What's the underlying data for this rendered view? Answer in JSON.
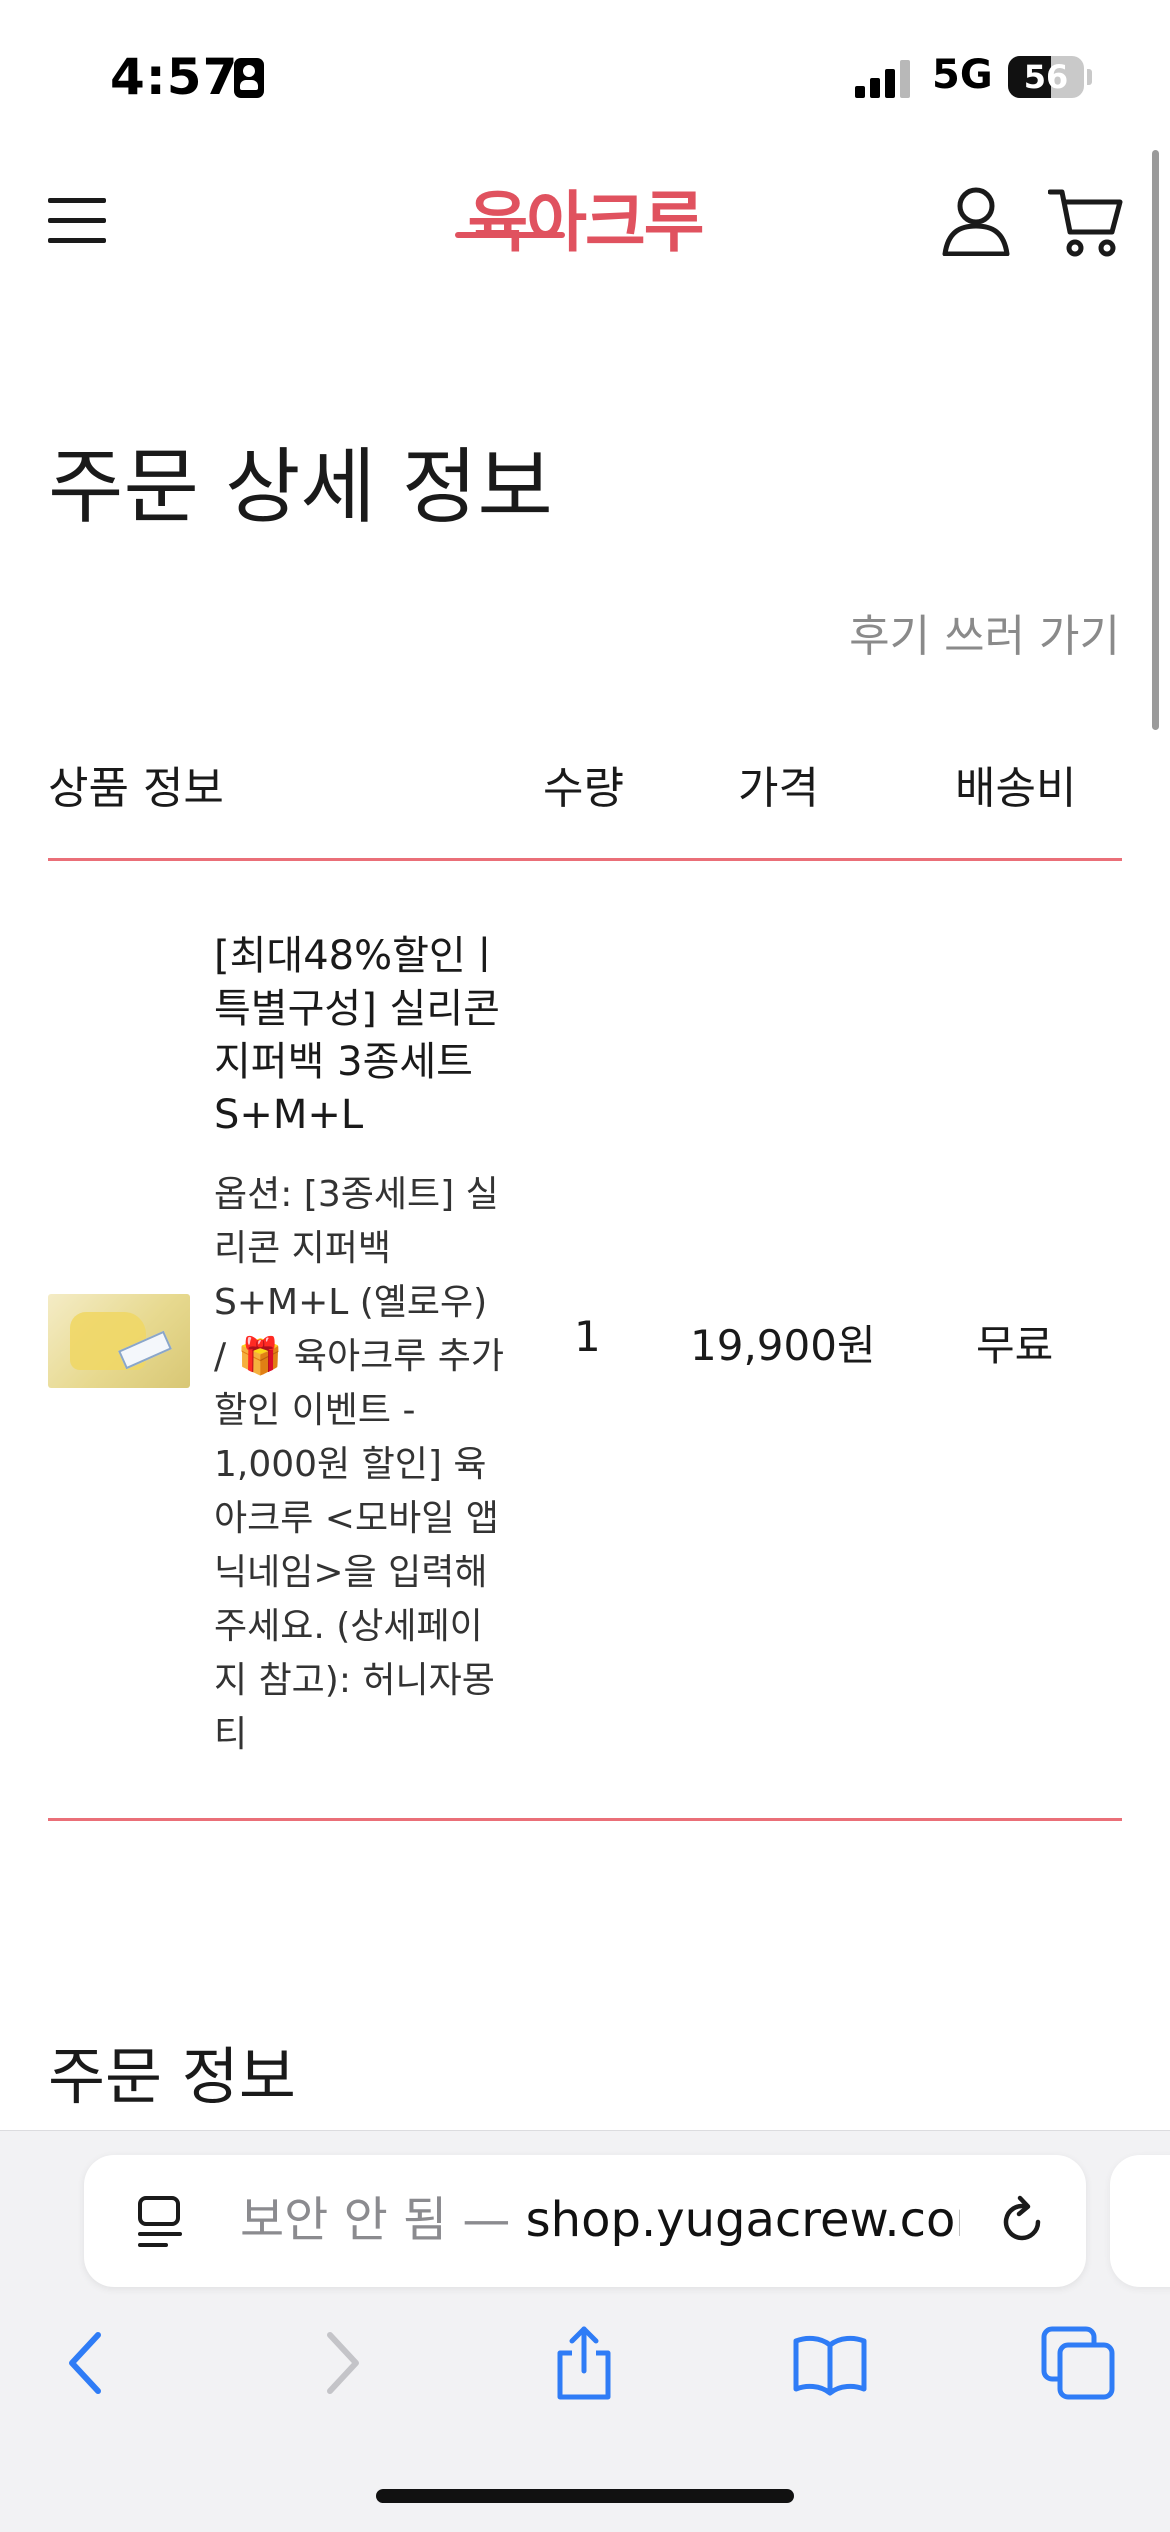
{
  "status_bar": {
    "time": "4:57",
    "network": "5G",
    "battery": "56",
    "battery_level": 0.56
  },
  "header": {
    "logo": "육아크루",
    "brand_color": "#e0525f"
  },
  "page": {
    "title": "주문 상세 정보",
    "review_link": "후기 쓰러 가기"
  },
  "table": {
    "headers": {
      "product": "상품 정보",
      "qty": "수량",
      "price": "가격",
      "shipping": "배송비"
    },
    "rows": [
      {
        "name": "[최대48%할인ㅣ특별구성] 실리콘 지퍼백 3종세트 S+M+L",
        "option": "옵션: [3종세트] 실리콘 지퍼백 S+M+L (옐로우) / 🎁 육아크루 추가할인 이벤트 - 1,000원 할인] 육아크루 <모바일 앱 닉네임>을 입력해주세요. (상세페이지 참고): 허니자몽티",
        "qty": "1",
        "price": "19,900원",
        "shipping": "무료"
      }
    ]
  },
  "order_section": {
    "title": "주문 정보"
  },
  "browser": {
    "url_prefix": "보안 안 됨 — ",
    "url_domain": "shop.yugacrew.com"
  },
  "icons": {
    "menu": "hamburger-menu-icon",
    "user": "user-icon",
    "cart": "cart-icon",
    "reader": "reader-mode-icon",
    "reload": "reload-icon",
    "back": "back-icon",
    "forward": "forward-icon",
    "share": "share-icon",
    "bookmarks": "bookmarks-icon",
    "tabs": "tabs-icon"
  }
}
